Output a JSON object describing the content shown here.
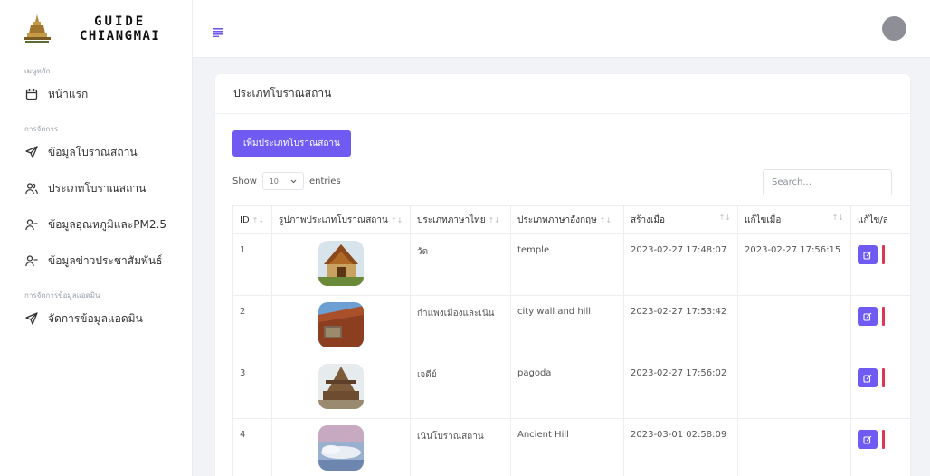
{
  "brand": {
    "line1": "GUIDE",
    "line2": "CHIANGMAI"
  },
  "sidebar": {
    "sections": [
      {
        "header": "เมนูหลัก",
        "items": [
          {
            "label": "หน้าแรก",
            "icon": "calendar-icon"
          }
        ]
      },
      {
        "header": "การจัดการ",
        "items": [
          {
            "label": "ข้อมูลโบราณสถาน",
            "icon": "send-icon"
          },
          {
            "label": "ประเภทโบราณสถาน",
            "icon": "users-icon"
          },
          {
            "label": "ข้อมูลอุณหภูมิและPM2.5",
            "icon": "user-minus-icon"
          },
          {
            "label": "ข้อมูลข่าวประชาสัมพันธ์",
            "icon": "user-minus-icon"
          }
        ]
      },
      {
        "header": "การจัดการข้อมูลแอดมิน",
        "items": [
          {
            "label": "จัดการข้อมูลแอดมิน",
            "icon": "send-icon"
          }
        ]
      }
    ]
  },
  "card": {
    "title": "ประเภทโบราณสถาน",
    "add_button": "เพิ่มประเภทโบราณสถาน",
    "show_label": "Show",
    "entries_value": "10",
    "entries_label": "entries",
    "search_placeholder": "Search..."
  },
  "table": {
    "columns": [
      "ID",
      "รูปภาพประเภทโบราณสถาน",
      "ประเภทภาษาไทย",
      "ประเภทภาษาอังกฤษ",
      "สร้างเมื่อ",
      "แก้ไขเมื่อ",
      "แก้ไข/ล"
    ],
    "rows": [
      {
        "id": "1",
        "thai": "วัด",
        "english": "temple",
        "created": "2023-02-27 17:48:07",
        "updated": "2023-02-27 17:56:15",
        "image": "temple-photo"
      },
      {
        "id": "2",
        "thai": "กำแพงเมืองและเนิน",
        "english": "city wall and hill",
        "created": "2023-02-27 17:53:42",
        "updated": "",
        "image": "city-wall-photo"
      },
      {
        "id": "3",
        "thai": "เจดีย์",
        "english": "pagoda",
        "created": "2023-02-27 17:56:02",
        "updated": "",
        "image": "pagoda-photo"
      },
      {
        "id": "4",
        "thai": "เนินโบราณสถาน",
        "english": "Ancient Hill",
        "created": "2023-03-01 02:58:09",
        "updated": "",
        "image": "ancient-hill-photo"
      }
    ]
  },
  "colors": {
    "accent": "#6f5bf2",
    "danger": "#e03454",
    "avatar": "#8e8f96"
  }
}
